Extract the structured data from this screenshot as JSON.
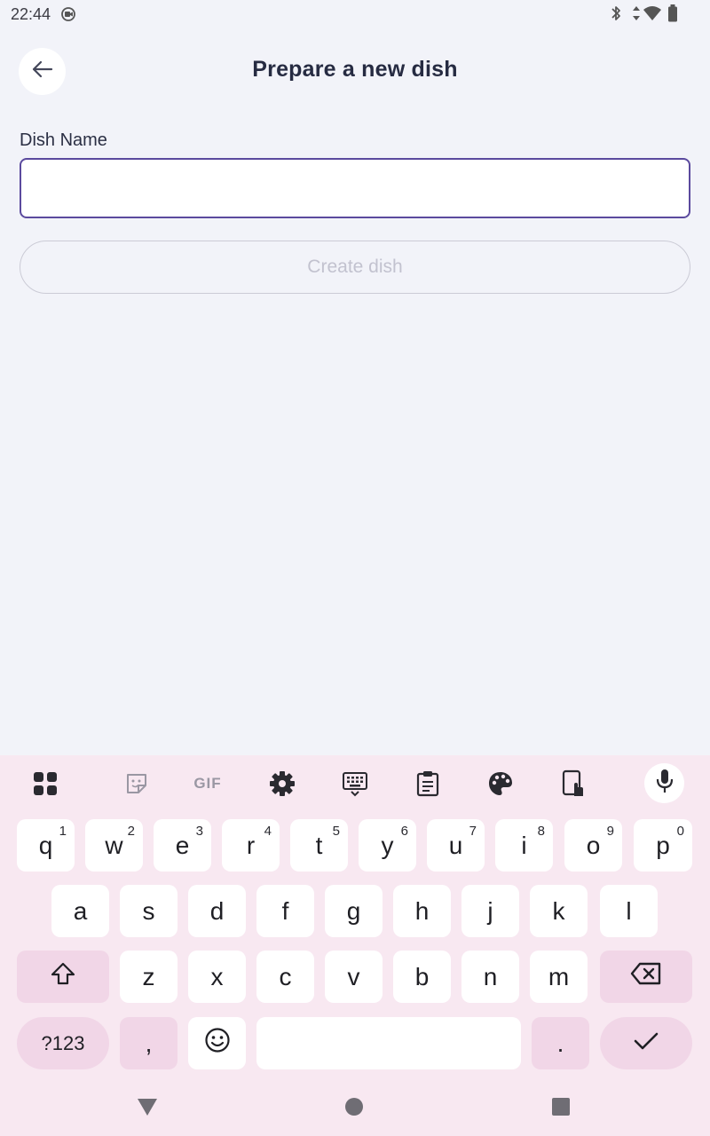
{
  "status_bar": {
    "time": "22:44"
  },
  "header": {
    "title": "Prepare a new dish"
  },
  "form": {
    "dish_name_label": "Dish Name",
    "dish_name_value": "",
    "create_button_label": "Create dish"
  },
  "keyboard": {
    "row1": [
      {
        "key": "q",
        "sup": "1"
      },
      {
        "key": "w",
        "sup": "2"
      },
      {
        "key": "e",
        "sup": "3"
      },
      {
        "key": "r",
        "sup": "4"
      },
      {
        "key": "t",
        "sup": "5"
      },
      {
        "key": "y",
        "sup": "6"
      },
      {
        "key": "u",
        "sup": "7"
      },
      {
        "key": "i",
        "sup": "8"
      },
      {
        "key": "o",
        "sup": "9"
      },
      {
        "key": "p",
        "sup": "0"
      }
    ],
    "row2": [
      "a",
      "s",
      "d",
      "f",
      "g",
      "h",
      "j",
      "k",
      "l"
    ],
    "row3": [
      "z",
      "x",
      "c",
      "v",
      "b",
      "n",
      "m"
    ],
    "symbols_label": "?123",
    "comma_label": ",",
    "period_label": ".",
    "gif_label": "GIF"
  },
  "colors": {
    "background": "#f2f3f9",
    "input_border": "#5b4a9e",
    "keyboard_bg": "#f8e8f1",
    "function_key": "#f1d6e7"
  }
}
